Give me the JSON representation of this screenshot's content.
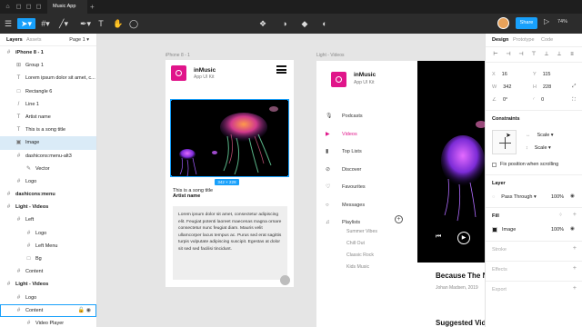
{
  "window": {
    "tab_title": "Music App"
  },
  "toolbar": {
    "share_label": "Share",
    "zoom": "74%"
  },
  "layers_panel": {
    "tab_layers": "Layers",
    "tab_assets": "Assets",
    "page": "Page 1",
    "items": [
      {
        "label": "iPhone 8 - 1",
        "icon": "#",
        "indent": 0,
        "type": "frame"
      },
      {
        "label": "Group 1",
        "icon": "⊞",
        "indent": 1,
        "type": "group"
      },
      {
        "label": "Lorem ipsum dolor sit amet, c...",
        "icon": "T",
        "indent": 1,
        "type": "text"
      },
      {
        "label": "Rectangle 6",
        "icon": "□",
        "indent": 1,
        "type": "shape"
      },
      {
        "label": "Line 1",
        "icon": "/",
        "indent": 1,
        "type": "line"
      },
      {
        "label": "Artist name",
        "icon": "T",
        "indent": 1,
        "type": "text"
      },
      {
        "label": "This is a song title",
        "icon": "T",
        "indent": 1,
        "type": "text"
      },
      {
        "label": "Image",
        "icon": "▣",
        "indent": 1,
        "type": "image",
        "selected": true
      },
      {
        "label": "dashicons:menu-alt3",
        "icon": "#",
        "indent": 1,
        "type": "component"
      },
      {
        "label": "Vector",
        "icon": "✎",
        "indent": 2,
        "type": "vector"
      },
      {
        "label": "Logo",
        "icon": "#",
        "indent": 1,
        "type": "component"
      },
      {
        "label": "dashicons:menu",
        "icon": "#",
        "indent": 0,
        "type": "frame"
      },
      {
        "label": "Light - Videos",
        "icon": "#",
        "indent": 0,
        "type": "frame"
      },
      {
        "label": "Left",
        "icon": "#",
        "indent": 1,
        "type": "frame"
      },
      {
        "label": "Logo",
        "icon": "#",
        "indent": 2,
        "type": "frame"
      },
      {
        "label": "Left Menu",
        "icon": "#",
        "indent": 2,
        "type": "frame"
      },
      {
        "label": "Bg",
        "icon": "□",
        "indent": 2,
        "type": "shape"
      },
      {
        "label": "Content",
        "icon": "#",
        "indent": 1,
        "type": "frame"
      },
      {
        "label": "Light - Videos",
        "icon": "#",
        "indent": 0,
        "type": "frame"
      },
      {
        "label": "Logo",
        "icon": "#",
        "indent": 1,
        "type": "frame"
      },
      {
        "label": "Content",
        "icon": "#",
        "indent": 1,
        "type": "frame",
        "hover": true
      },
      {
        "label": "Video Player",
        "icon": "#",
        "indent": 2,
        "type": "frame"
      }
    ]
  },
  "canvas": {
    "phone_frame_label": "iPhone 8 - 1",
    "videos_frame_label": "Light - Videos",
    "phone": {
      "app_name": "inMusic",
      "app_sub": "App UI Kit",
      "dimension_badge": "342 × 228",
      "song_title": "This is a song title",
      "artist": "Artist name",
      "lorem": "Lorem ipsum dolor sit amet, consectetur adipiscing elit. Feugiat potenti laoreet maecenas magna ornare consectetur nunc feugiat diam. Mauris velit ullamcorper lacus tempus ac. Purus sed erat sagittis turpis vulputate adipiscing suscipit. Egestas at dolor sit sed sed facilisi tincidunt."
    },
    "videos": {
      "app_name": "inMusic",
      "app_sub": "App UI Kit",
      "nav": [
        {
          "label": "Podcasts",
          "icon": "🎙"
        },
        {
          "label": "Videos",
          "icon": "▶",
          "active": true
        },
        {
          "label": "Top Lists",
          "icon": "▮"
        },
        {
          "label": "Discover",
          "icon": "⊘"
        },
        {
          "label": "Favourites",
          "icon": "♡"
        },
        {
          "label": "Messages",
          "icon": "○"
        },
        {
          "label": "Playlists",
          "icon": "♫"
        }
      ],
      "playlists": [
        "Summer Vibes",
        "Chill Out",
        "Classic Rock",
        "Kids Music"
      ],
      "video_title": "Because The Ni",
      "video_meta": "Johan Madsen, 2019",
      "suggested": "Suggested Vide"
    }
  },
  "design_panel": {
    "tabs": [
      "Design",
      "Prototype",
      "Code"
    ],
    "x": "16",
    "y": "115",
    "w": "342",
    "h": "228",
    "rotation": "0°",
    "radius": "0",
    "constraints_title": "Constraints",
    "constraint_h": "Scale",
    "constraint_v": "Scale",
    "fix_position": "Fix position when scrolling",
    "layer_title": "Layer",
    "blend_mode": "Pass Through",
    "layer_opacity": "100%",
    "fill_title": "Fill",
    "fill_type": "Image",
    "fill_opacity": "100%",
    "stroke_title": "Stroke",
    "effects_title": "Effects",
    "export_title": "Export"
  },
  "colors": {
    "accent": "#18a0fb",
    "brand": "#e0158a"
  }
}
